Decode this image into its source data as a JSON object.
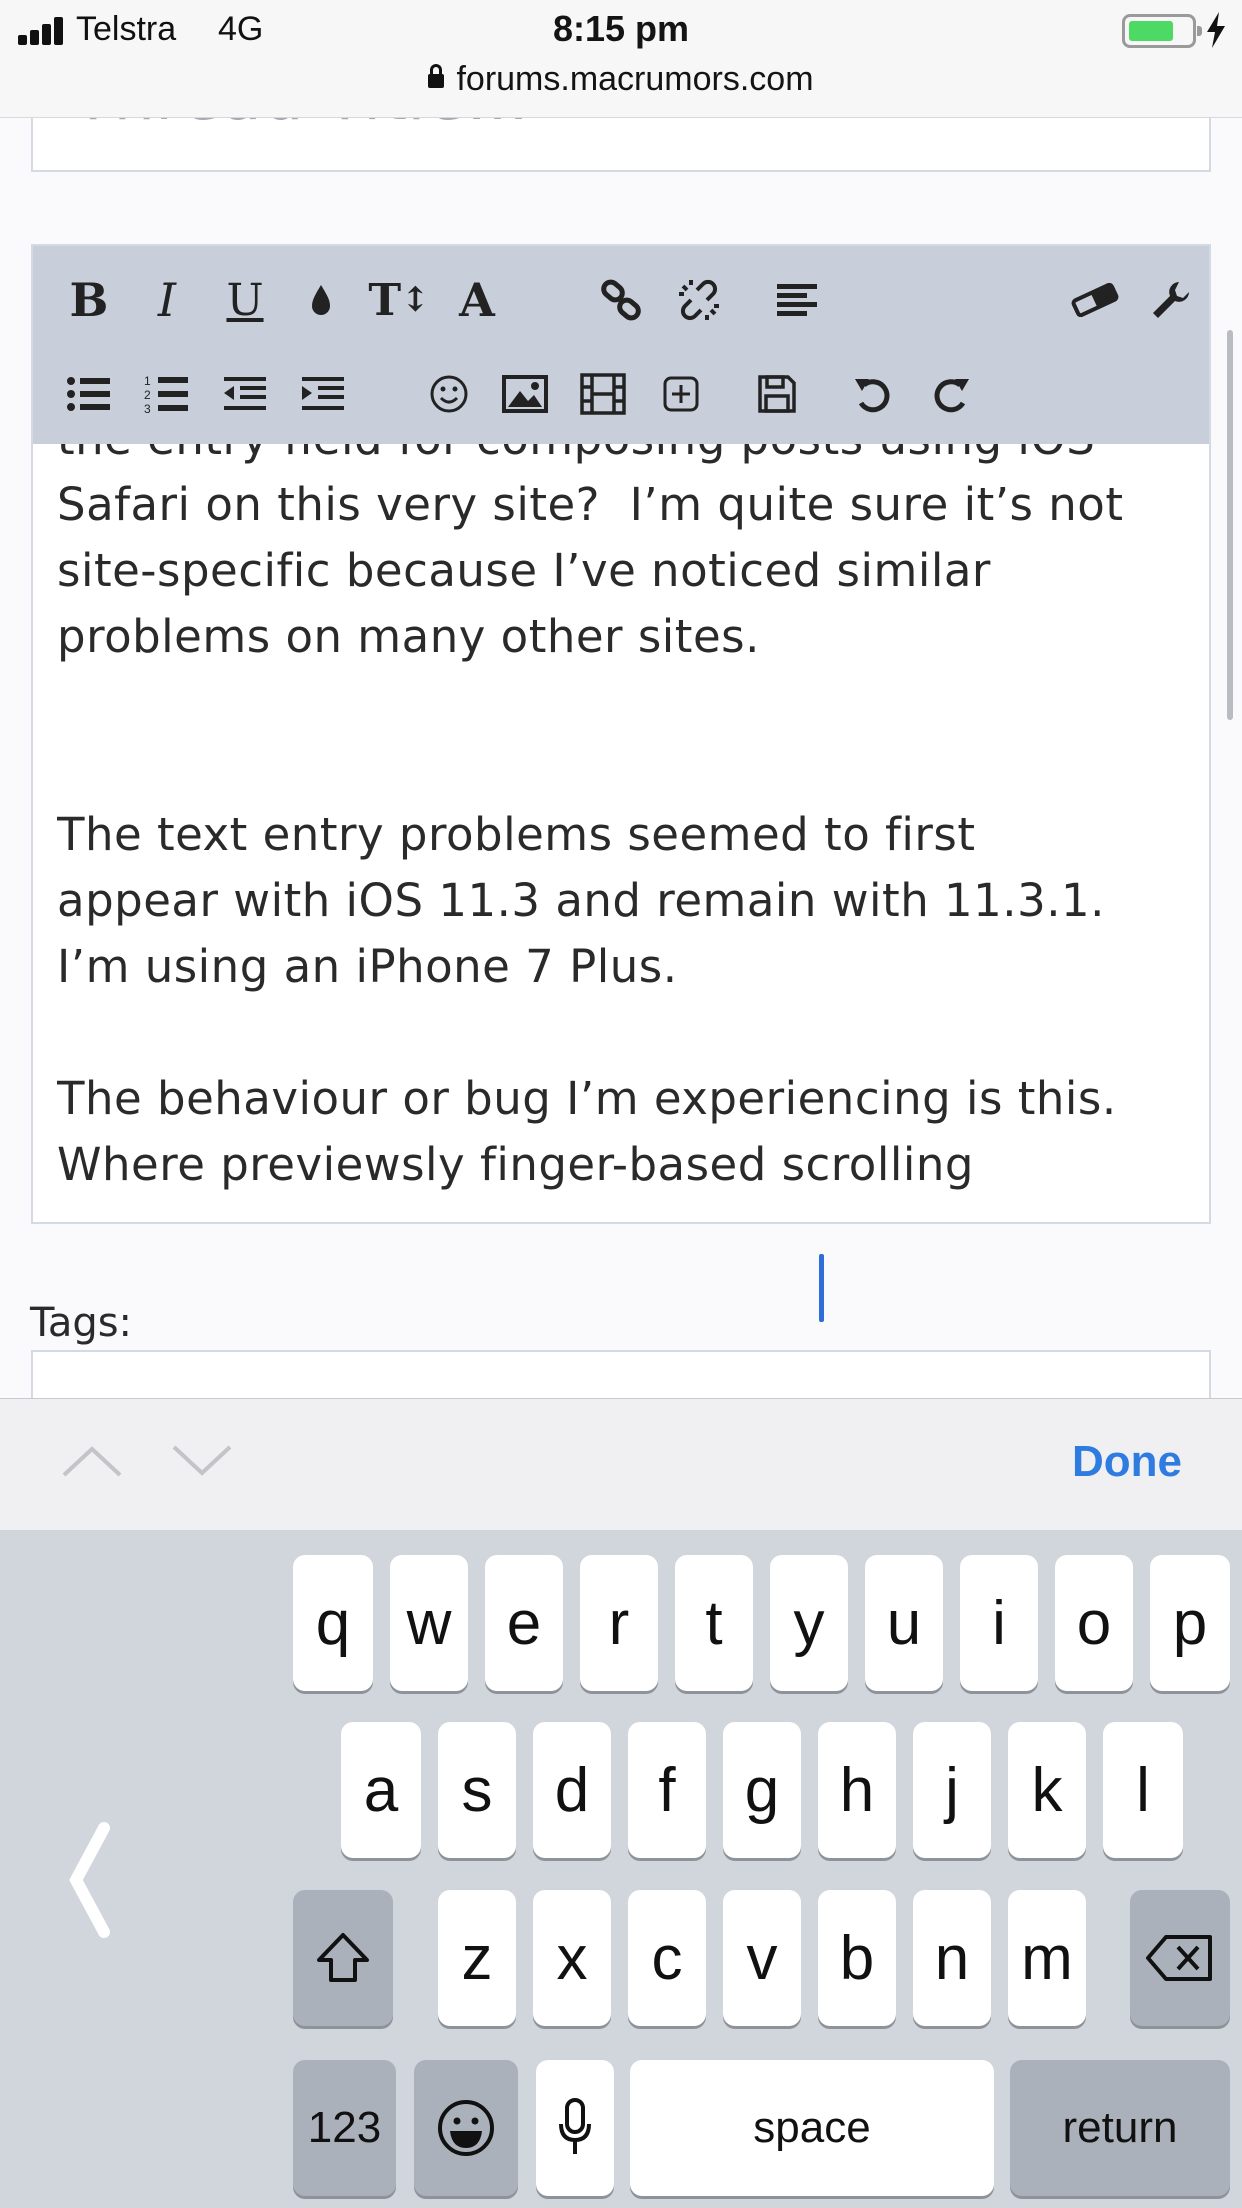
{
  "status_bar": {
    "carrier": "Telstra",
    "network": "4G",
    "time": "8:15 pm",
    "url": "forums.macrumors.com",
    "battery_color": "#4cd964"
  },
  "title_field": {
    "visible_text": "Thread Title..."
  },
  "editor": {
    "toolbar_row1": [
      "bold-icon",
      "italic-icon",
      "underline-icon",
      "color-drop-icon",
      "font-size-icon",
      "font-family-icon",
      "link-icon",
      "unlink-icon",
      "align-icon",
      "eraser-icon",
      "wrench-icon"
    ],
    "toolbar_row2": [
      "bullet-list-icon",
      "numbered-list-icon",
      "outdent-icon",
      "indent-icon",
      "smilie-icon",
      "image-icon",
      "media-icon",
      "insert-icon",
      "save-draft-icon",
      "undo-icon",
      "redo-icon"
    ],
    "text": "the entry field for composing posts using iOS\nSafari on this very site?  I’m quite sure it’s not\nsite-specific because I’ve noticed similar\nproblems on many other sites.\n\n\nThe text entry problems seemed to first\nappear with iOS 11.3 and remain with 11.3.1.\nI’m using an iPhone 7 Plus.\n\nThe behaviour or bug I’m experiencing is this.\nWhere previewsly finger-based scrolling"
  },
  "tags": {
    "label": "Tags:"
  },
  "accessory": {
    "done_label": "Done",
    "accent_color": "#2f7ce0"
  },
  "keyboard": {
    "row1": [
      "q",
      "w",
      "e",
      "r",
      "t",
      "y",
      "u",
      "i",
      "o",
      "p"
    ],
    "row2": [
      "a",
      "s",
      "d",
      "f",
      "g",
      "h",
      "j",
      "k",
      "l"
    ],
    "row3": [
      "z",
      "x",
      "c",
      "v",
      "b",
      "n",
      "m"
    ],
    "numbers_label": "123",
    "space_label": "space",
    "return_label": "return",
    "back_glyph": "‹"
  }
}
